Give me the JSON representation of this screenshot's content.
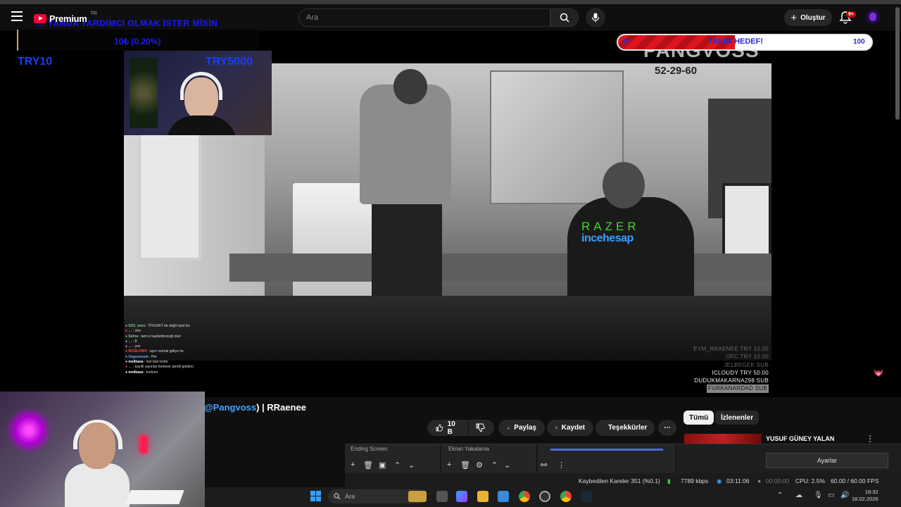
{
  "header": {
    "logo_text": "Premium",
    "logo_region": "TR",
    "search_placeholder": "Ara",
    "create_label": "Oluştur",
    "notifications_badge": "9+"
  },
  "stream_overlay": {
    "goal_text": "… YANDA YARDIMCI OLMAK İSTER MİSİN",
    "goal_value": "10₺ (0.20%)",
    "try_left": "TRY10",
    "try_right": "TRY5000",
    "team_goal_min": "46",
    "team_goal_label": "TAKIM HEDEF!",
    "team_goal_max": "100",
    "team_goal_progress": 0.46,
    "watermark": "PANGVOSS",
    "video_phone": "52-29-60",
    "sponsor_razer": "RAZER",
    "sponsor_incehesap": "incehesap",
    "chat_lines": [
      {
        "user": "S2G_enes",
        "msg": ": İTKUSKT de değil niyet bu",
        "color": "#7fd17f"
      },
      {
        "user": "…",
        "msg": ": ohe",
        "color": "#ff4444"
      },
      {
        "user": "Sehra",
        "msg": ": tam iz kaybettireceği olan",
        "color": "#7fd17f"
      },
      {
        "user": "…",
        "msg": ": 8",
        "color": "#7aa7ff"
      },
      {
        "user": "…",
        "msg": ": yes",
        "color": "#7aa7ff"
      },
      {
        "user": "MOSLOWX",
        "msg": ": aşırı normal gidiyo he",
        "color": "#ff4444"
      },
      {
        "user": "Uzgunuzum",
        "msg": ": Hm",
        "color": "#7aa7ff"
      },
      {
        "user": "melikasa",
        "msg": ": tsei bak tovbe",
        "color": "#ffffff"
      },
      {
        "user": "…",
        "msg": ": kayıfli yayınlar herkese (şimdi geldim)",
        "color": "#ff4444"
      },
      {
        "user": "melikasa",
        "msg": ": korkum",
        "color": "#ffffff"
      }
    ],
    "donors": [
      {
        "text": "EYM_RRAENEE TRY 10.00",
        "style": "dim"
      },
      {
        "text": "OFC TRY 10.00",
        "style": "dim"
      },
      {
        "text": "JELBEGEK SUB",
        "style": "dim"
      },
      {
        "text": "ICLOUDY TRY 50.00",
        "style": "normal"
      },
      {
        "text": "DUDUKMAKARNA298 SUB",
        "style": "normal"
      },
      {
        "text": "FURKANARDAD SUB",
        "style": "hl"
      }
    ]
  },
  "video_info": {
    "title_mention": "@Pangvoss",
    "title_rest": ") | RRaenee",
    "like_count": "10 B",
    "share_label": "Paylaş",
    "save_label": "Kaydet",
    "thanks_label": "Teşekkürler",
    "more_label": "⋯"
  },
  "recommendations": {
    "tabs": [
      {
        "label": "Tümü",
        "active": true
      },
      {
        "label": "İzlenenler",
        "active": false
      }
    ],
    "first_title": "YUSUF GÜNEY YALAN MAKİNESİNDE!"
  },
  "obs": {
    "scene_label": "Ending Screen",
    "source_label": "Ekran Yakalama",
    "settings_label": "Ayarlar",
    "dropped_frames": "Kaybedilen Kareler 351 (%0.1)",
    "bitrate": "7789 kbps",
    "stream_time": "03:11:06",
    "record_time": "00:00:00",
    "cpu": "CPU: 2.5%",
    "fps": "60.00 / 60.00 FPS"
  },
  "taskbar": {
    "search_placeholder": "Ara",
    "time": "18:32",
    "date": "18.02.2026"
  },
  "colors": {
    "accent_red": "#ff0033",
    "link_blue": "#3ea6ff",
    "overlay_blue": "#1a3cff",
    "razer_green": "#44d62c"
  }
}
